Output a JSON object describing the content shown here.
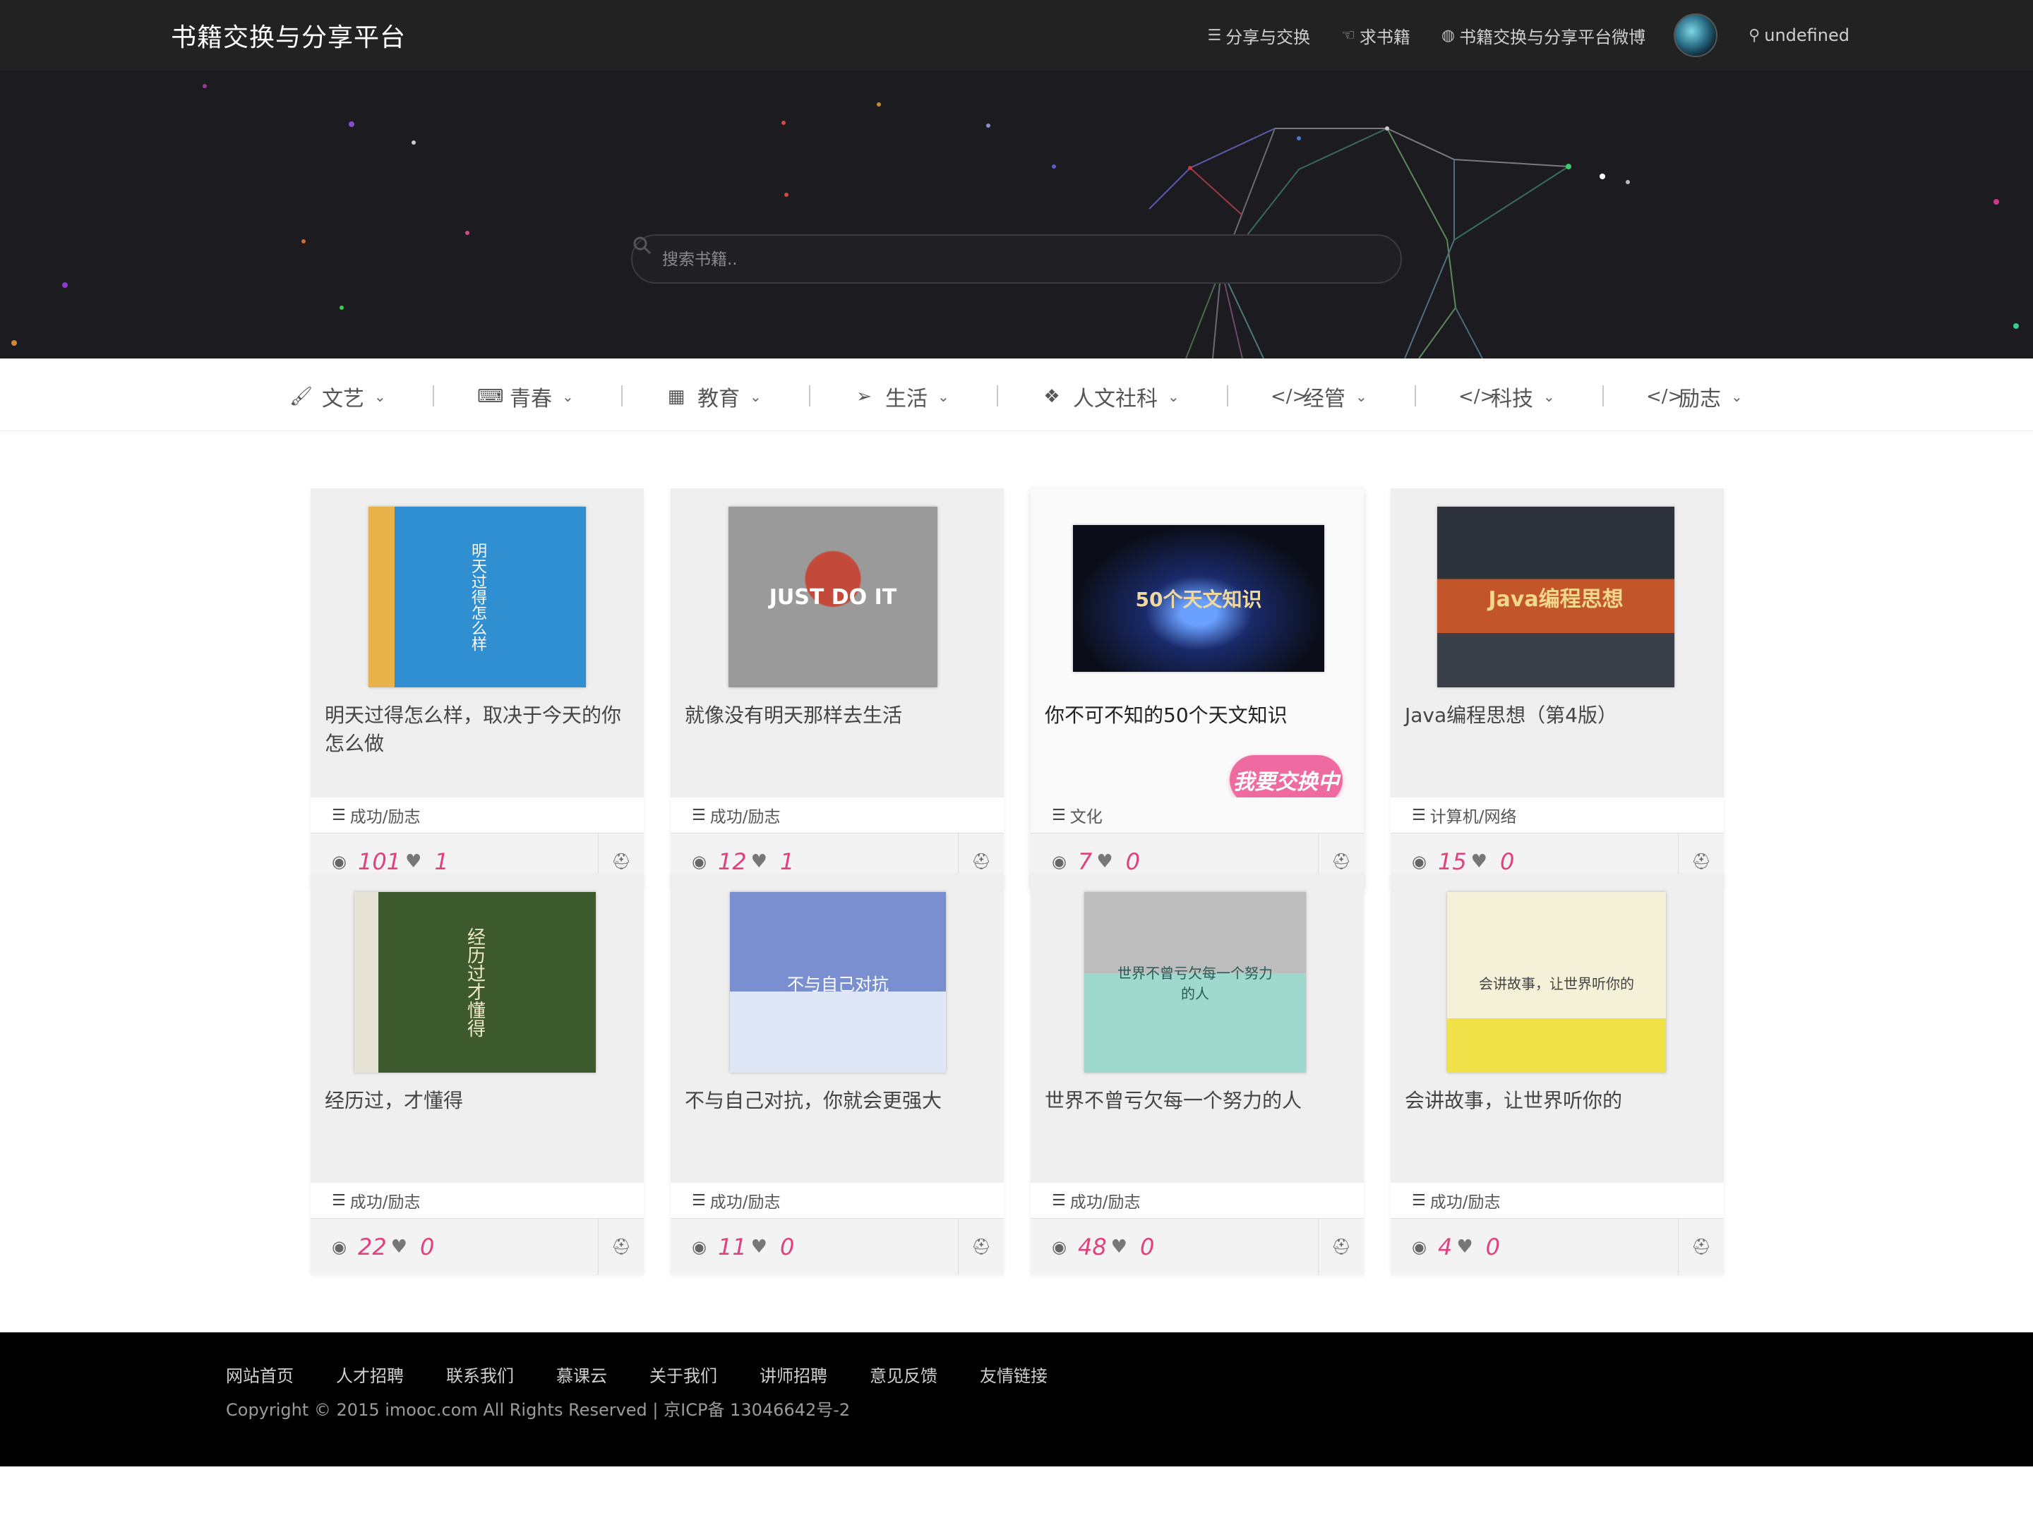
{
  "header": {
    "brand": "书籍交换与分享平台",
    "nav": [
      {
        "icon": "list-icon",
        "label": "分享与交换"
      },
      {
        "icon": "hand-pointer-icon",
        "label": "求书籍"
      },
      {
        "icon": "weibo-icon",
        "label": "书籍交换与分享平台微博"
      }
    ],
    "location": "undefined"
  },
  "search": {
    "placeholder": "搜索书籍.."
  },
  "categories": [
    {
      "icon": "paint-brush-icon",
      "label": "文艺"
    },
    {
      "icon": "keyboard-icon",
      "label": "青春"
    },
    {
      "icon": "film-icon",
      "label": "教育"
    },
    {
      "icon": "paper-plane-icon",
      "label": "生活"
    },
    {
      "icon": "dropbox-icon",
      "label": "人文社科"
    },
    {
      "icon": "code-icon",
      "label": "经管"
    },
    {
      "icon": "code-icon",
      "label": "科技"
    },
    {
      "icon": "code-icon",
      "label": "励志"
    }
  ],
  "books": [
    {
      "title": "明天过得怎么样，取决于今天的你怎么做",
      "category": "成功/励志",
      "views": "101",
      "likes": "1"
    },
    {
      "title": "就像没有明天那样去生活",
      "category": "成功/励志",
      "views": "12",
      "likes": "1"
    },
    {
      "title": "你不可不知的50个天文知识",
      "category": "文化",
      "views": "7",
      "likes": "0",
      "badge": "我要交换中"
    },
    {
      "title": "Java编程思想（第4版）",
      "category": "计算机/网络",
      "views": "15",
      "likes": "0"
    },
    {
      "title": "经历过，才懂得",
      "category": "成功/励志",
      "views": "22",
      "likes": "0"
    },
    {
      "title": "不与自己对抗，你就会更强大",
      "category": "成功/励志",
      "views": "11",
      "likes": "0"
    },
    {
      "title": "世界不曾亏欠每一个努力的人",
      "category": "成功/励志",
      "views": "48",
      "likes": "0"
    },
    {
      "title": "会讲故事，让世界听你的",
      "category": "成功/励志",
      "views": "4",
      "likes": "0"
    }
  ],
  "covers": [
    {
      "bg": "#2f8fd0",
      "text": "明天过得怎么样"
    },
    {
      "bg": "#8e8e8e",
      "text": "JUST DO IT"
    },
    {
      "bg": "#101522",
      "text": "50个天文知识"
    },
    {
      "bg": "#3a3f4a",
      "text": "Java编程思想"
    },
    {
      "bg": "#3d5a2e",
      "text": "经历过才懂得"
    },
    {
      "bg": "#7a8fd0",
      "text": "不与自己对抗"
    },
    {
      "bg": "#9fd8cc",
      "text": "世界不曾亏欠每一个努力的人"
    },
    {
      "bg": "#f5f0d8",
      "text": "会讲故事，让世界听你的"
    }
  ],
  "footer": {
    "links": [
      "网站首页",
      "人才招聘",
      "联系我们",
      "慕课云",
      "关于我们",
      "讲师招聘",
      "意见反馈",
      "友情链接"
    ],
    "copyright": "Copyright © 2015 imooc.com All Rights Reserved | 京ICP备 13046642号-2"
  },
  "colors": {
    "accent": "#e0427f",
    "badge": "#f06aa2",
    "nav_bg": "#222222",
    "hero_bg": "#1b1b20"
  }
}
